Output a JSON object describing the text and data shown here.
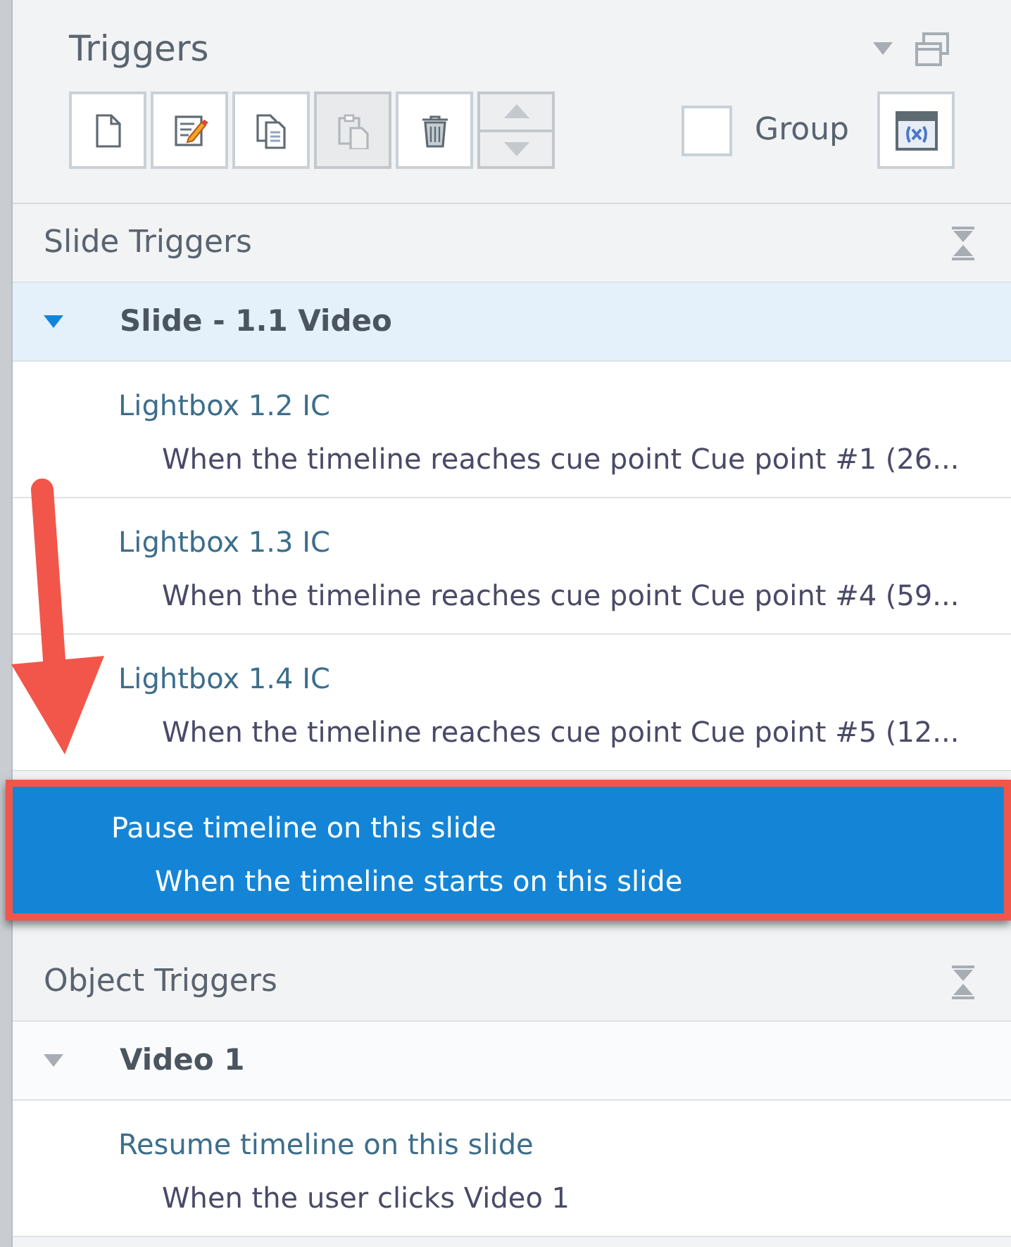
{
  "panel": {
    "title": "Triggers"
  },
  "toolbar": [
    {
      "kind": "new",
      "disabled": false
    },
    {
      "kind": "edit",
      "disabled": false
    },
    {
      "kind": "copy",
      "disabled": false
    },
    {
      "kind": "paste",
      "disabled": true
    },
    {
      "kind": "delete",
      "disabled": false
    },
    {
      "kind": "move",
      "disabled": true
    }
  ],
  "group_checkbox": {
    "label": "Group",
    "checked": false
  },
  "sections": [
    {
      "title": "Slide Triggers",
      "groups": [
        {
          "name": "Slide - 1.1 Video",
          "expanded": true,
          "highlighted": true,
          "triggers": [
            {
              "action": "Lightbox 1.2 IC",
              "condition": "When the timeline reaches cue point Cue point #1 (26...",
              "selected": false
            },
            {
              "action": "Lightbox 1.3 IC",
              "condition": "When the timeline reaches cue point Cue point #4 (59...",
              "selected": false
            },
            {
              "action": "Lightbox 1.4 IC",
              "condition": "When the timeline reaches cue point Cue point #5 (12...",
              "selected": false
            },
            {
              "action": "Pause timeline on this slide",
              "condition": "When the timeline starts on this slide",
              "selected": true
            }
          ]
        }
      ]
    },
    {
      "title": "Object Triggers",
      "groups": [
        {
          "name": "Video 1",
          "expanded": true,
          "highlighted": false,
          "triggers": [
            {
              "action": "Resume timeline on this slide",
              "condition": "When the user clicks Video 1",
              "selected": false
            }
          ]
        }
      ]
    }
  ]
}
